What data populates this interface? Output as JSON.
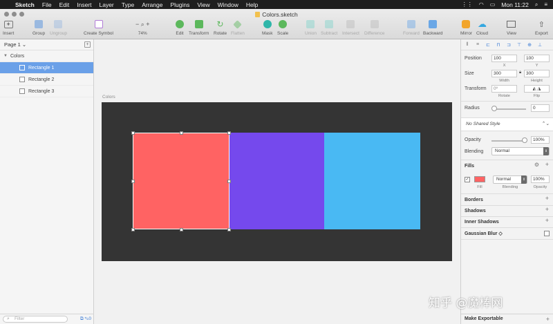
{
  "menubar": {
    "app": "Sketch",
    "items": [
      "File",
      "Edit",
      "Insert",
      "Layer",
      "Type",
      "Arrange",
      "Plugins",
      "View",
      "Window",
      "Help"
    ],
    "clock": "Mon 11:22"
  },
  "window": {
    "title": "Colors.sketch"
  },
  "toolbar": {
    "insert": "Insert",
    "group": "Group",
    "ungroup": "Ungroup",
    "create_symbol": "Create Symbol",
    "zoom": "74%",
    "edit": "Edit",
    "transform": "Transform",
    "rotate": "Rotate",
    "flatten": "Flatten",
    "mask": "Mask",
    "scale": "Scale",
    "union": "Union",
    "subtract": "Subtract",
    "intersect": "Intersect",
    "difference": "Difference",
    "forward": "Forward",
    "backward": "Backward",
    "mirror": "Mirror",
    "cloud": "Cloud",
    "view": "View",
    "export": "Export"
  },
  "layers": {
    "page": "Page 1",
    "group": "Colors",
    "items": [
      "Rectangle 1",
      "Rectangle 2",
      "Rectangle 3"
    ],
    "filter_placeholder": "Filter",
    "footer_count": "0"
  },
  "canvas": {
    "artboard_name": "Colors",
    "colors": [
      "#ff6363",
      "#7549ed",
      "#49b9f3"
    ],
    "artboard_bg": "#343434"
  },
  "inspector": {
    "position_label": "Position",
    "x": "100",
    "y": "100",
    "x_label": "X",
    "y_label": "Y",
    "size_label": "Size",
    "width": "300",
    "height": "300",
    "width_label": "Width",
    "height_label": "Height",
    "transform_label": "Transform",
    "rotate_value": "0º",
    "rotate_label": "Rotate",
    "flip_label": "Flip",
    "radius_label": "Radius",
    "radius": "0",
    "shared_style": "No Shared Style",
    "opacity_label": "Opacity",
    "opacity": "100%",
    "blending_label": "Blending",
    "blending": "Normal",
    "fills_label": "Fills",
    "fill_blending": "Normal",
    "fill_opacity": "100%",
    "fill_sub": "Fill",
    "fill_blending_sub": "Blending",
    "fill_opacity_sub": "Opacity",
    "fill_color": "#ff6363",
    "borders": "Borders",
    "shadows": "Shadows",
    "inner_shadows": "Inner Shadows",
    "gaussian_blur": "Gaussian Blur ◇",
    "make_exportable": "Make Exportable"
  },
  "watermark": "知乎 @魔棒网"
}
